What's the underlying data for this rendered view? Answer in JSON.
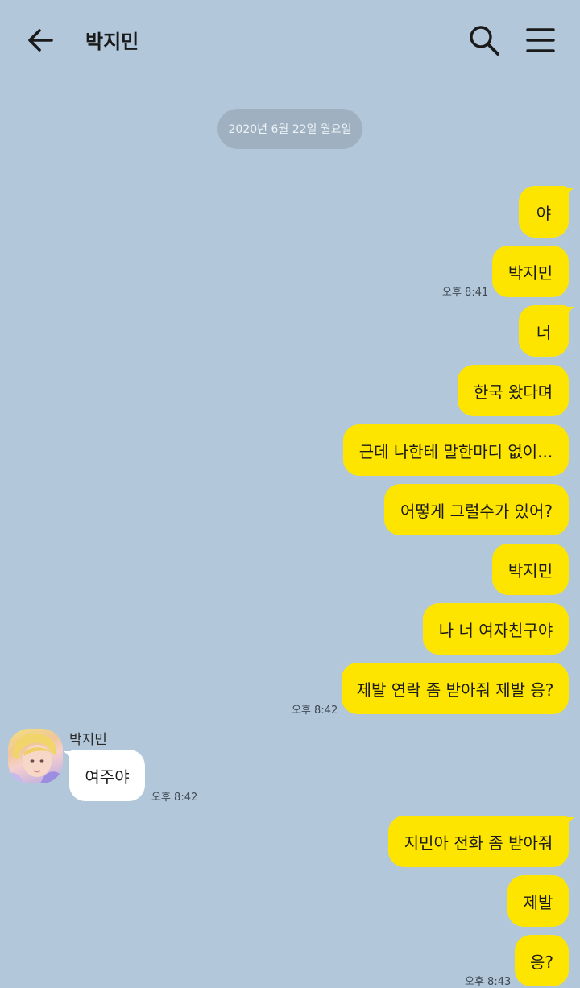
{
  "header": {
    "title": "박지민"
  },
  "date_divider": "2020년 6월 22일 월요일",
  "messages": [
    {
      "text": "야"
    },
    {
      "text": "박지민",
      "time": "오후 8:41"
    },
    {
      "text": "너"
    },
    {
      "text": "한국 왔다며"
    },
    {
      "text": "근데 나한테 말한마디 없이..."
    },
    {
      "text": "어떻게 그럴수가 있어?"
    },
    {
      "text": "박지민"
    },
    {
      "text": "나 너 여자친구야"
    },
    {
      "text": "제발 연락 좀 받아줘 제발 응?",
      "time": "오후 8:42"
    },
    {
      "sender": "박지민",
      "text": "여주야",
      "time": "오후 8:42"
    },
    {
      "text": "지민아 전화 좀 받아줘"
    },
    {
      "text": "제발"
    },
    {
      "text": "응?",
      "time": "오후 8:43"
    }
  ],
  "colors": {
    "background": "#b2c7da",
    "outgoing": "#fee500",
    "incoming": "#ffffff",
    "date_pill": "#9fb1c1"
  },
  "icons": {
    "back": "arrow-left-icon",
    "search": "search-icon",
    "menu": "hamburger-menu-icon"
  }
}
